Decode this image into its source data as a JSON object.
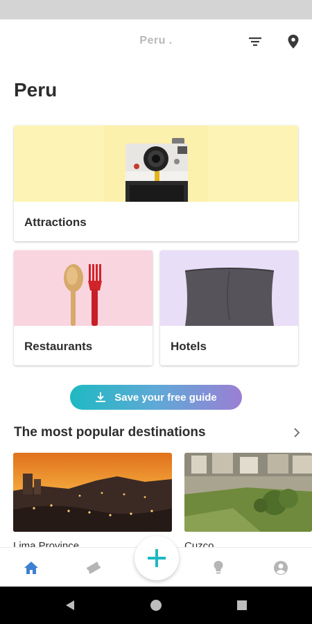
{
  "app_bar": {
    "title": "Peru .",
    "filter_icon": "filter-icon",
    "location_icon": "location-pin-icon"
  },
  "page": {
    "title": "Peru"
  },
  "categories": [
    {
      "label": "Attractions",
      "image": "camera",
      "color": "#fdf3b5"
    },
    {
      "label": "Restaurants",
      "image": "spoon-and-fork",
      "color": "#f9d5df"
    },
    {
      "label": "Hotels",
      "image": "pillow",
      "color": "#e9def7"
    }
  ],
  "save_guide": {
    "label": "Save your free guide",
    "icon": "download-icon"
  },
  "popular": {
    "title": "The most popular destinations",
    "arrow_icon": "chevron-right-icon",
    "destinations": [
      {
        "name": "Lima Province"
      },
      {
        "name": "Cuzco"
      }
    ]
  },
  "bottom_nav": {
    "items": [
      "home-icon",
      "ticket-icon",
      "add-icon",
      "lightbulb-icon",
      "profile-icon"
    ],
    "active_color": "#3f7fd1",
    "inactive_color": "#b5b5b5",
    "fab_color": "#1fb9c2"
  },
  "system_nav": [
    "back-icon",
    "home-circle-icon",
    "recents-icon"
  ]
}
